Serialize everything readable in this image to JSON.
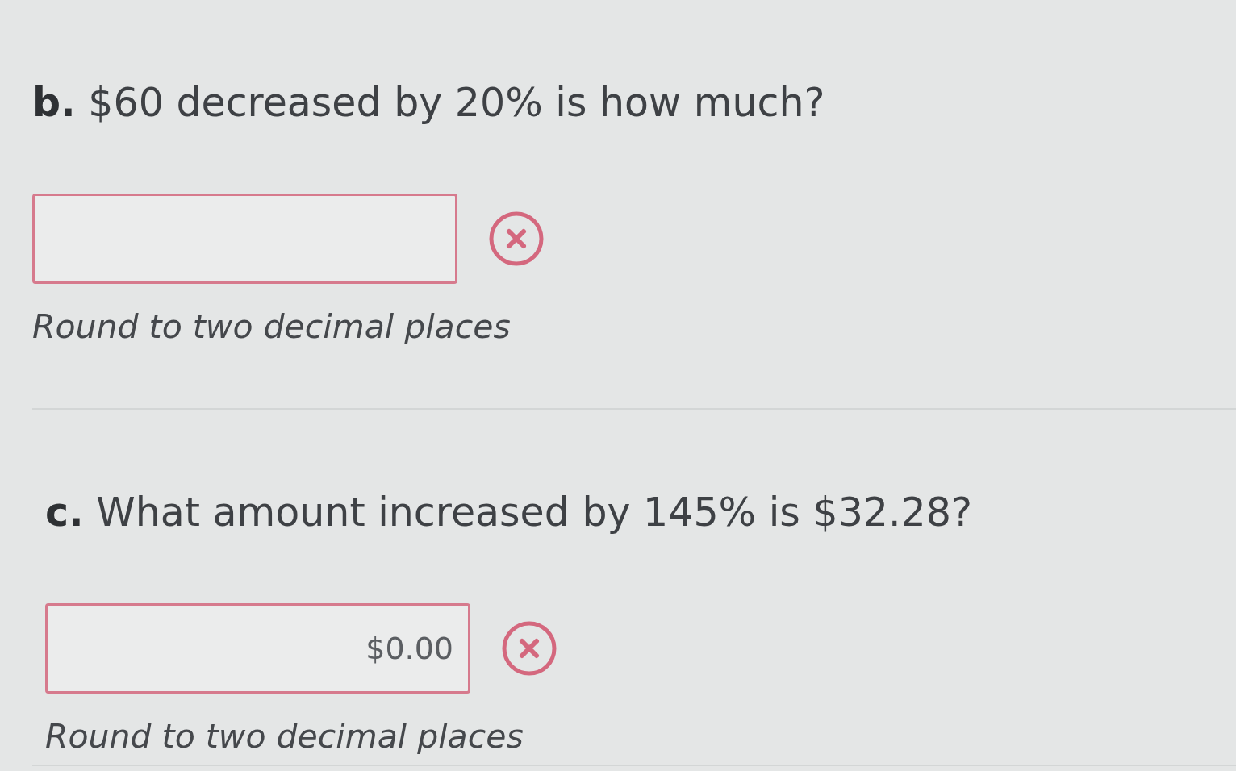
{
  "questions": [
    {
      "prompt": "**b.** $60 decreased by 20% is how much?",
      "answer_box": {
        "correct": false
      },
      "hint": "Round to two decimal places"
    },
    {
      "prompt": "**c.** What amount increased by 145% is $32.28?",
      "answer_box": {
        "value": "$0.00",
        "correct": false
      },
      "hint": "Round to two decimal places"
    }
  ]
}
